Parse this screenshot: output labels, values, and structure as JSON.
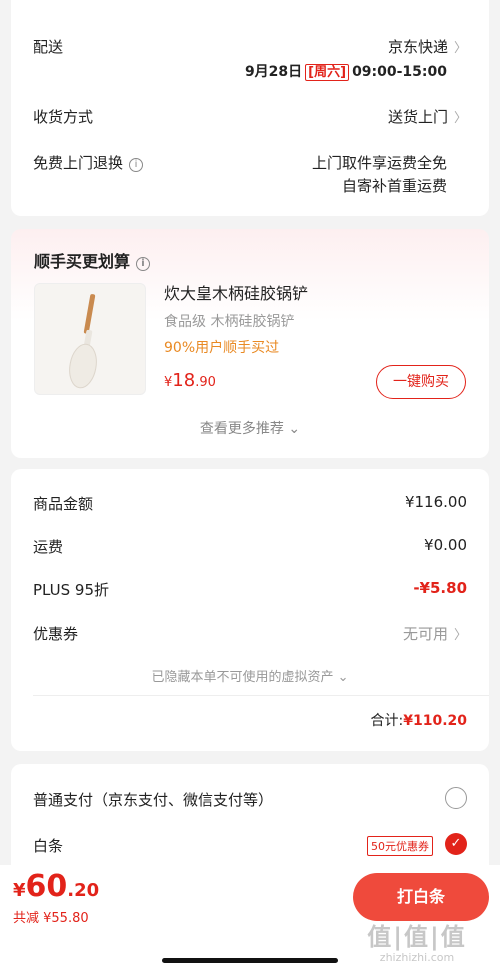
{
  "delivery": {
    "shipping_label": "配送",
    "carrier": "京东快递",
    "date": "9月28日",
    "weekday": "[周六]",
    "time": "09:00-15:00",
    "receive_label": "收货方式",
    "receive_value": "送货上门",
    "return_label": "免费上门退换",
    "return_line1": "上门取件享运费全免",
    "return_line2": "自寄补首重运费"
  },
  "recommend": {
    "title": "顺手买更划算",
    "product_name": "炊大皇木柄硅胶锅铲",
    "product_desc": "食品级 木柄硅胶锅铲",
    "popularity": "90%用户顺手买过",
    "price_symbol": "¥",
    "price_int": "18",
    "price_dec": ".90",
    "buy_button": "一键购买",
    "more": "查看更多推荐"
  },
  "summary": {
    "goods_label": "商品金额",
    "goods_value": "¥116.00",
    "freight_label": "运费",
    "freight_value": "¥0.00",
    "plus_label": "PLUS 95折",
    "plus_value": "-¥5.80",
    "coupon_label": "优惠券",
    "coupon_value": "无可用",
    "hidden_note": "已隐藏本单不可使用的虚拟资产",
    "total_label": "合计:",
    "total_value": "¥110.20"
  },
  "payment": {
    "normal_label": "普通支付（京东支付、微信支付等）",
    "baitiao_label": "白条",
    "baitiao_coupon": "50元优惠券"
  },
  "bottom": {
    "price_symbol": "¥",
    "price_int": "60",
    "price_dec": ".20",
    "saving": "共减 ¥55.80",
    "pay_button": "打白条"
  },
  "watermark": {
    "big": "值|值|值",
    "url": "zhizhizhi.com"
  },
  "colors": {
    "accent": "#e2231a",
    "background": "#f3f3f3"
  }
}
